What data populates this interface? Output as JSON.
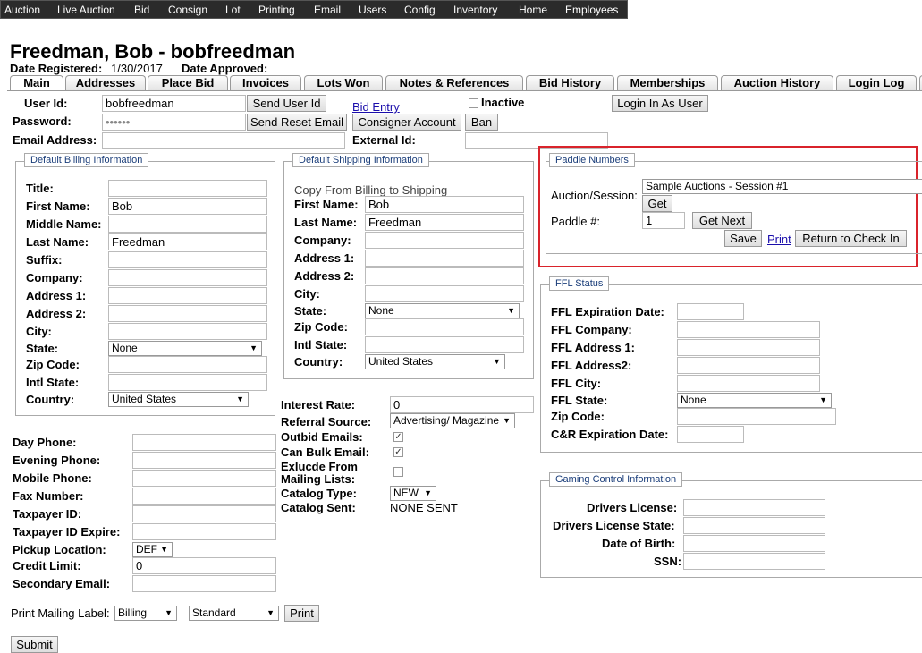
{
  "menu": [
    "Auction",
    "Live Auction",
    "Bid",
    "Consign",
    "Lot",
    "Printing",
    "Email",
    "Users",
    "Config",
    "Inventory",
    "Home",
    "Employees"
  ],
  "header": {
    "title": "Freedman, Bob - bobfreedman",
    "date_registered_label": "Date Registered:",
    "date_registered": "1/30/2017",
    "date_approved_label": "Date Approved:"
  },
  "tabs": [
    "Main",
    "Addresses",
    "Place Bid",
    "Invoices",
    "Lots Won",
    "Notes & References",
    "Bid History",
    "Memberships",
    "Auction History",
    "Login Log"
  ],
  "account": {
    "user_id_label": "User Id:",
    "user_id": "bobfreedman",
    "send_user_id": "Send User Id",
    "bid_entry": "Bid Entry",
    "inactive_label": "Inactive",
    "login_as_user": "Login In As User",
    "password_label": "Password:",
    "password": "••••••",
    "send_reset_email": "Send Reset Email",
    "consigner_account": "Consigner Account",
    "ban": "Ban",
    "email_label": "Email Address:",
    "external_id_label": "External Id:"
  },
  "billing": {
    "legend": "Default Billing Information",
    "title_label": "Title:",
    "first_name_label": "First Name:",
    "first_name": "Bob",
    "middle_name_label": "Middle Name:",
    "last_name_label": "Last Name:",
    "last_name": "Freedman",
    "suffix_label": "Suffix:",
    "company_label": "Company:",
    "address1_label": "Address 1:",
    "address2_label": "Address 2:",
    "city_label": "City:",
    "state_label": "State:",
    "state": "None",
    "zip_label": "Zip Code:",
    "intl_state_label": "Intl State:",
    "country_label": "Country:",
    "country": "United States"
  },
  "shipping": {
    "legend": "Default Shipping Information",
    "copy_link": "Copy From Billing to Shipping",
    "first_name_label": "First Name:",
    "first_name": "Bob",
    "last_name_label": "Last Name:",
    "last_name": "Freedman",
    "company_label": "Company:",
    "address1_label": "Address 1:",
    "address2_label": "Address 2:",
    "city_label": "City:",
    "state_label": "State:",
    "state": "None",
    "zip_label": "Zip Code:",
    "intl_state_label": "Intl State:",
    "country_label": "Country:",
    "country": "United States"
  },
  "paddle": {
    "legend": "Paddle Numbers",
    "session_label": "Auction/Session:",
    "session": "Sample Auctions - Session #1",
    "get": "Get",
    "paddle_label": "Paddle #:",
    "paddle": "1",
    "get_next": "Get Next",
    "save": "Save",
    "print": "Print",
    "return_to_check_in": "Return to Check In"
  },
  "ffl": {
    "legend": "FFL Status",
    "expiration_label": "FFL Expiration Date:",
    "company_label": "FFL Company:",
    "address1_label": "FFL Address 1:",
    "address2_label": "FFL Address2:",
    "city_label": "FFL City:",
    "state_label": "FFL State:",
    "state": "None",
    "zip_label": "Zip Code:",
    "cr_expiration_label": "C&R Expiration Date:"
  },
  "gaming": {
    "legend": "Gaming Control Information",
    "drivers_license_label": "Drivers License:",
    "drivers_license_state_label": "Drivers License State:",
    "dob_label": "Date of Birth:",
    "ssn_label": "SSN:"
  },
  "contact": {
    "day_phone_label": "Day Phone:",
    "evening_phone_label": "Evening Phone:",
    "mobile_phone_label": "Mobile Phone:",
    "fax_label": "Fax Number:",
    "taxpayer_id_label": "Taxpayer ID:",
    "taxpayer_expire_label": "Taxpayer ID Expire:",
    "pickup_label": "Pickup Location:",
    "pickup": "DEF",
    "credit_limit_label": "Credit Limit:",
    "credit_limit": "0",
    "secondary_email_label": "Secondary Email:"
  },
  "prefs": {
    "interest_rate_label": "Interest Rate:",
    "interest_rate": "0",
    "referral_label": "Referral Source:",
    "referral": "Advertising/ Magazine",
    "outbid_label": "Outbid Emails:",
    "outbid": true,
    "bulk_label": "Can Bulk Email:",
    "bulk": true,
    "exclude_label_1": "Exlucde From",
    "exclude_label_2": "Mailing Lists:",
    "exclude": false,
    "catalog_type_label": "Catalog Type:",
    "catalog_type": "NEW",
    "catalog_sent_label": "Catalog Sent:",
    "catalog_sent": "NONE SENT"
  },
  "footer": {
    "print_label": "Print Mailing Label:",
    "label_address": "Billing",
    "label_format": "Standard",
    "print": "Print",
    "submit": "Submit"
  },
  "colors": {
    "menubar": "#2b2b2b",
    "highlight": "#d9232b",
    "legend_text": "#1b3e7a",
    "link": "#1a0dab"
  }
}
